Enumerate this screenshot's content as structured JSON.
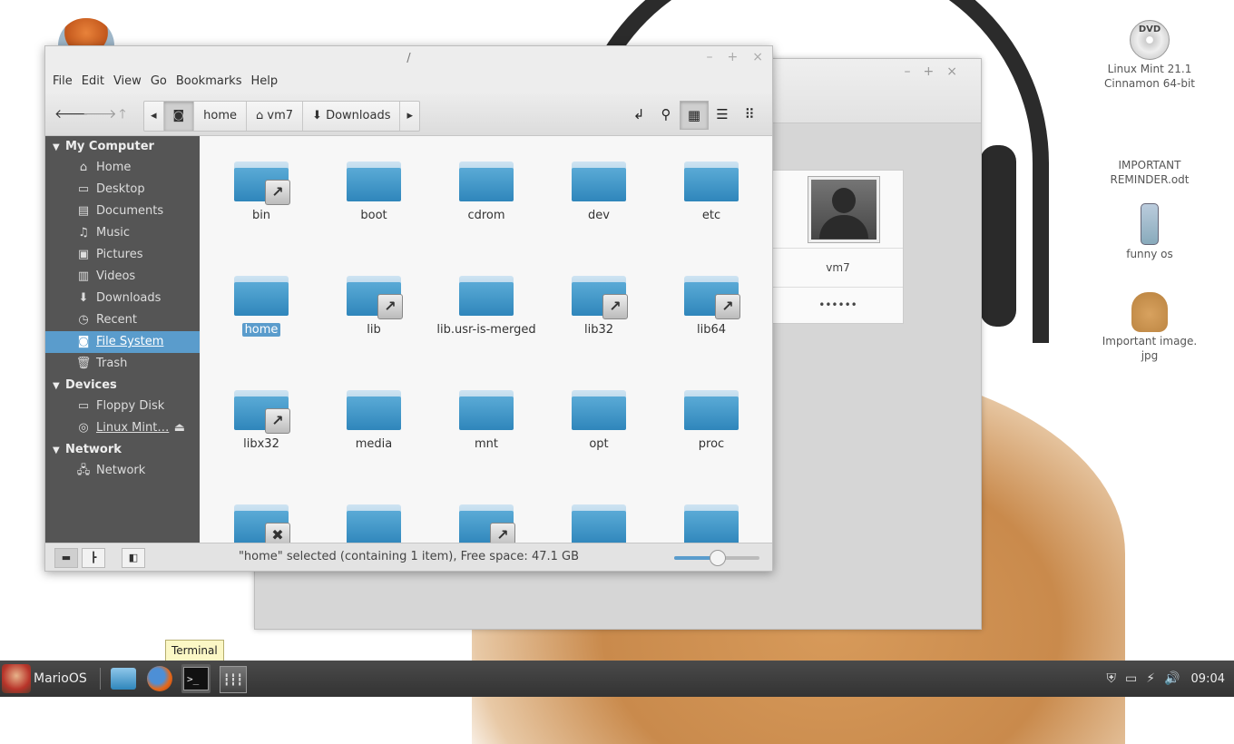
{
  "desktop": {
    "icons": [
      {
        "label": "Linux Mint 21.1 Cinnamon 64-bit",
        "line1": "Linux Mint 21.1",
        "line2": "Cinnamon 64-bit",
        "badge": "DVD"
      },
      {
        "label": "IMPORTANT REMINDER.odt",
        "line1": "IMPORTANT",
        "line2": "REMINDER.odt"
      },
      {
        "label": "funny os",
        "line1": "funny os"
      },
      {
        "label": "Important image.jpg",
        "line1": "Important image.",
        "line2": "jpg"
      }
    ]
  },
  "back_window": {
    "user_name": "vm7",
    "password_mask": "••••••"
  },
  "file_manager": {
    "title": "/",
    "menu": [
      "File",
      "Edit",
      "View",
      "Go",
      "Bookmarks",
      "Help"
    ],
    "breadcrumbs": [
      "home",
      "vm7",
      "Downloads"
    ],
    "sidebar": {
      "sections": [
        {
          "title": "My Computer",
          "items": [
            "Home",
            "Desktop",
            "Documents",
            "Music",
            "Pictures",
            "Videos",
            "Downloads",
            "Recent",
            "File System",
            "Trash"
          ]
        },
        {
          "title": "Devices",
          "items": [
            "Floppy Disk",
            "Linux Mint…"
          ]
        },
        {
          "title": "Network",
          "items": [
            "Network"
          ]
        }
      ],
      "selected": "File System"
    },
    "files": [
      {
        "name": "bin",
        "badge": "link"
      },
      {
        "name": "boot"
      },
      {
        "name": "cdrom"
      },
      {
        "name": "dev"
      },
      {
        "name": "etc"
      },
      {
        "name": "home",
        "selected": true
      },
      {
        "name": "lib",
        "badge": "link"
      },
      {
        "name": "lib.usr-is-merged"
      },
      {
        "name": "lib32",
        "badge": "link"
      },
      {
        "name": "lib64",
        "badge": "link"
      },
      {
        "name": "libx32",
        "badge": "link"
      },
      {
        "name": "media"
      },
      {
        "name": "mnt"
      },
      {
        "name": "opt"
      },
      {
        "name": "proc"
      },
      {
        "name": "",
        "badge": "broken"
      },
      {
        "name": ""
      },
      {
        "name": "",
        "badge": "link"
      },
      {
        "name": ""
      },
      {
        "name": ""
      }
    ],
    "status": "\"home\" selected (containing 1 item), Free space: 47.1 GB",
    "zoom_level": 0.5
  },
  "taskbar": {
    "menu_label": "MarioOS",
    "tooltip": "Terminal",
    "clock": "09:04"
  },
  "colors": {
    "selection": "#5a9ccc",
    "sidebar_bg": "#555555",
    "taskbar_bg": "#333333"
  }
}
